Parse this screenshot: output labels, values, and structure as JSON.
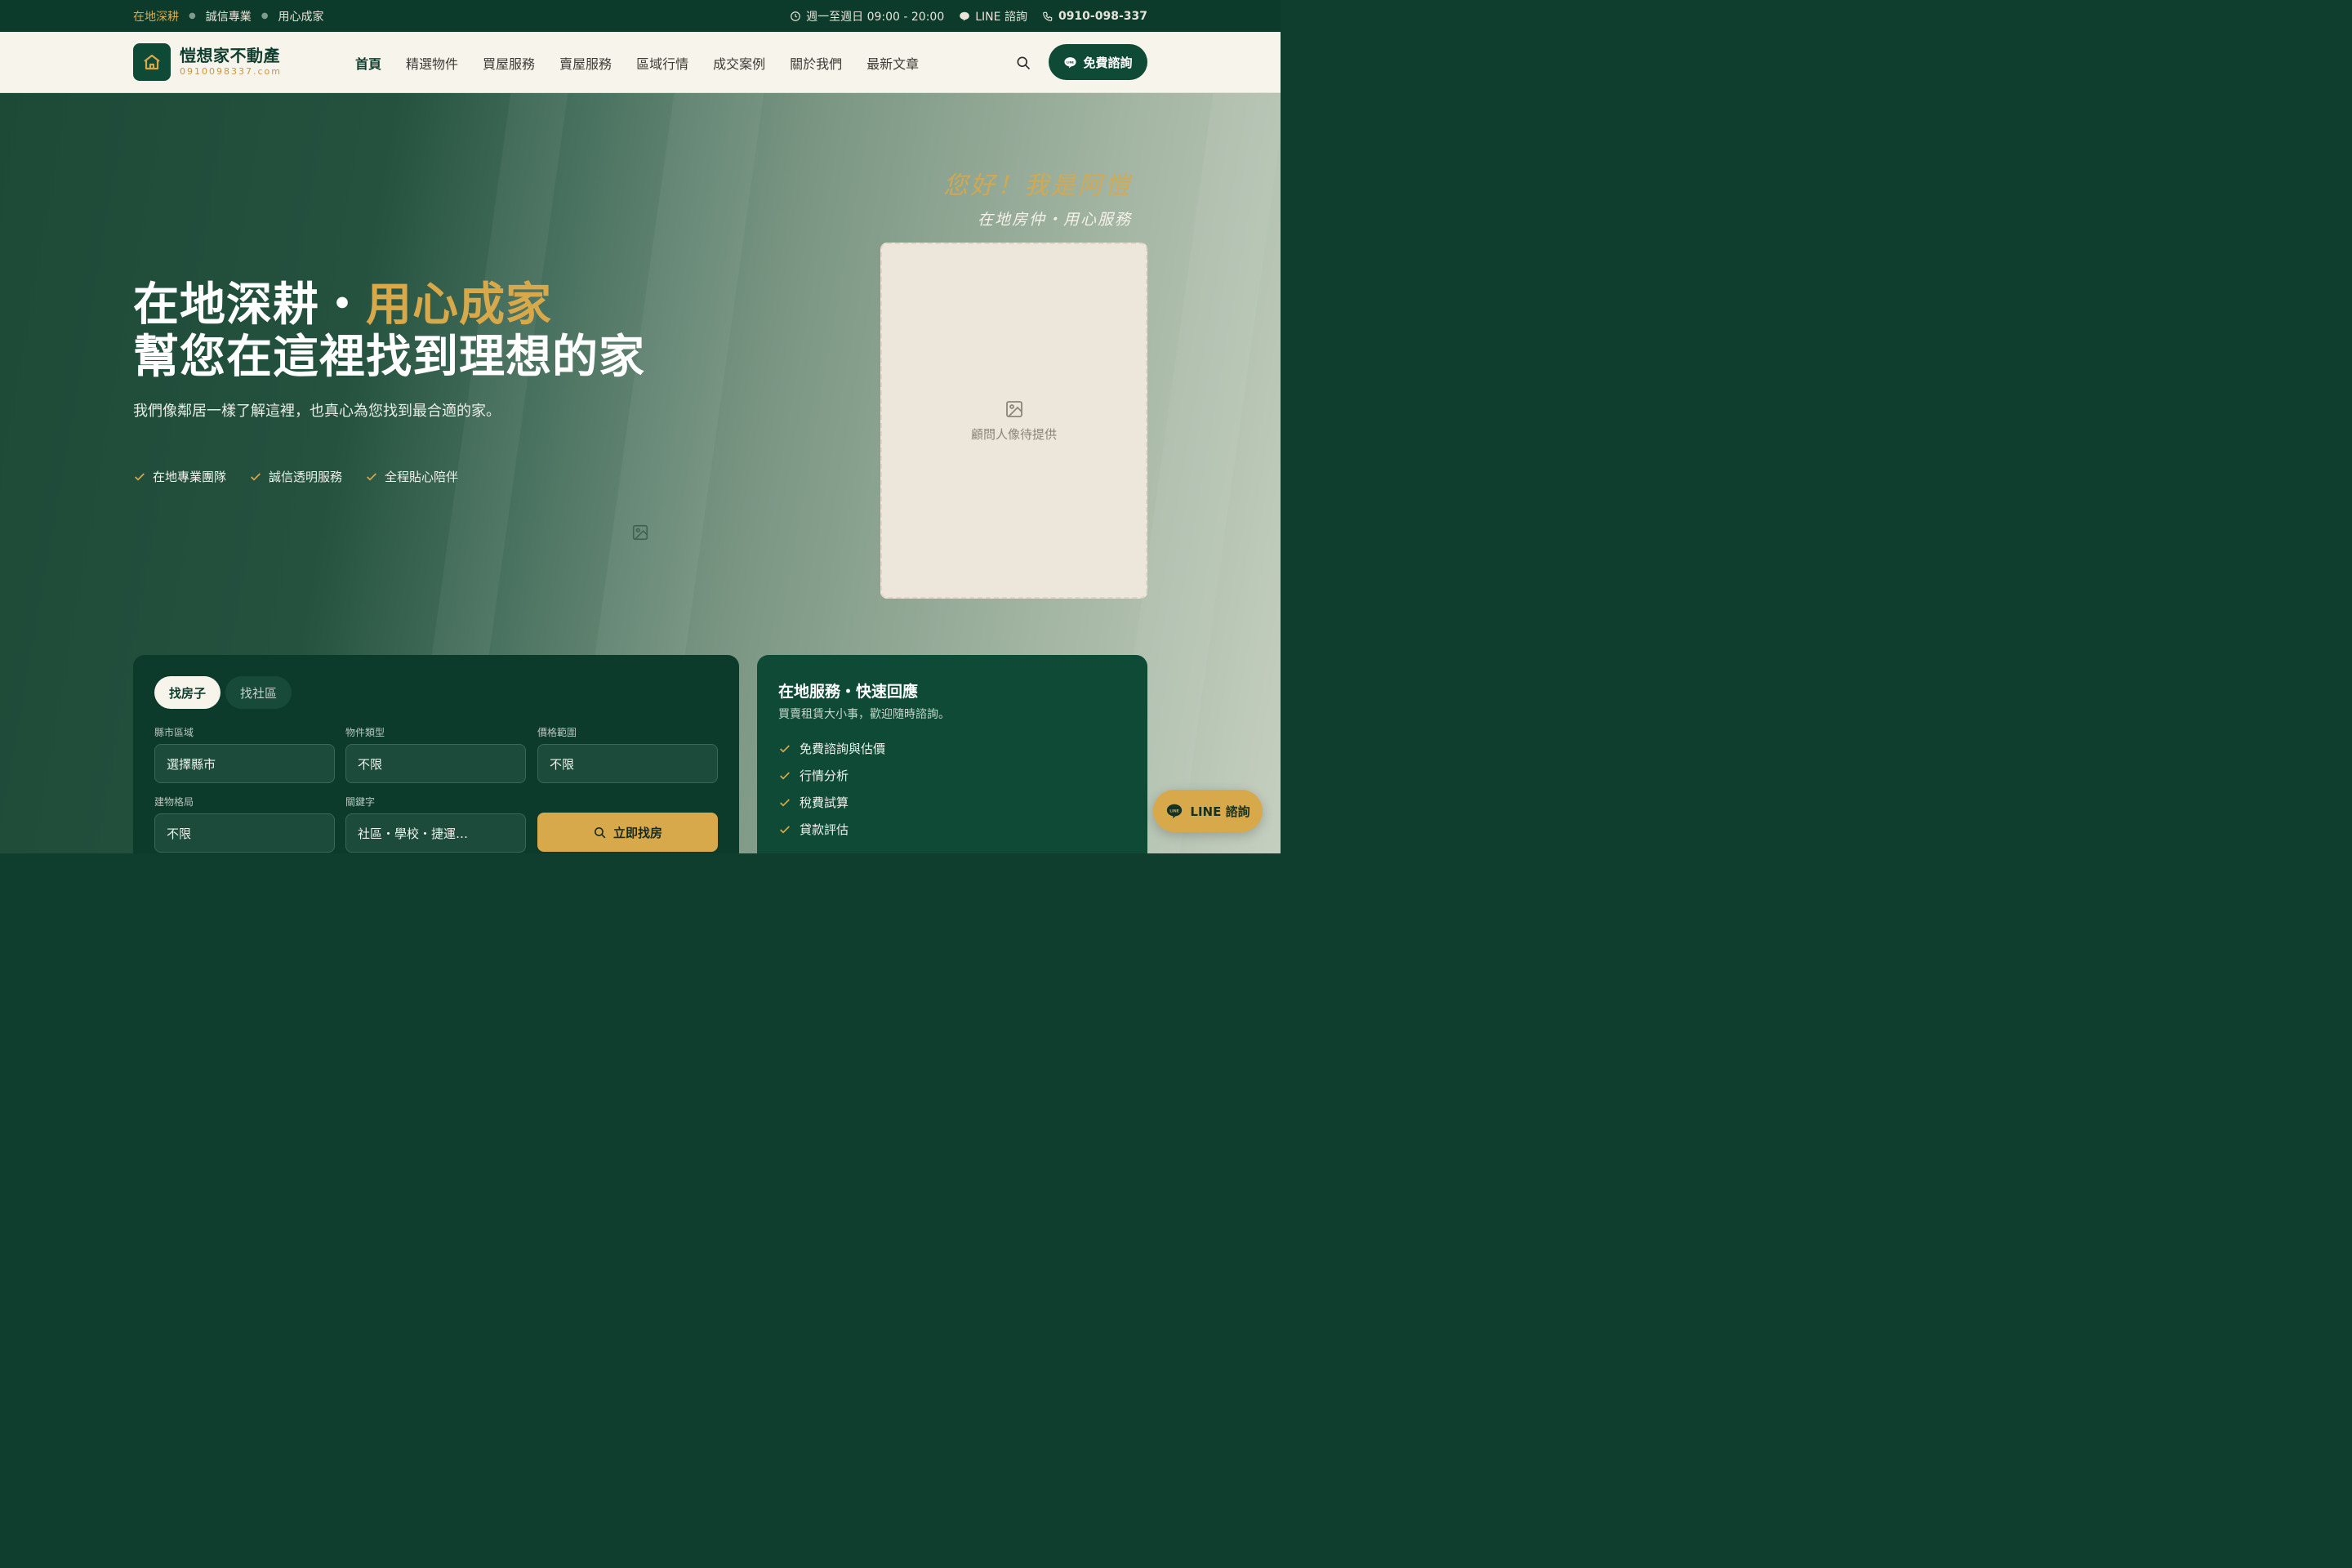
{
  "topbar": {
    "slogans": [
      "在地深耕",
      "誠信專業",
      "用心成家"
    ],
    "hours": "週一至週日 09:00 - 20:00",
    "line": "LINE 諮詢",
    "phone": "0910-098-337"
  },
  "header": {
    "brand_name": "愷想家不動產",
    "brand_domain": "0910098337.com",
    "nav": [
      "首頁",
      "精選物件",
      "買屋服務",
      "賣屋服務",
      "區域行情",
      "成交案例",
      "關於我們",
      "最新文章"
    ],
    "cta": "免費諮詢"
  },
  "hero": {
    "title_line1_white": "在地深耕・",
    "title_line1_gold": "用心成家",
    "title_line2": "幫您在這裡找到理想的家",
    "subtitle": "我們像鄰居一樣了解這裡，也真心為您找到最合適的家。",
    "features": [
      "在地專業團隊",
      "誠信透明服務",
      "全程貼心陪伴"
    ],
    "greeting": "您好！我是阿愷",
    "greeting_sub": "在地房仲・用心服務",
    "portrait_placeholder": "顧問人像待提供"
  },
  "search": {
    "tabs": [
      "找房子",
      "找社區"
    ],
    "fields": {
      "county": {
        "label": "縣市區域",
        "value": "選擇縣市"
      },
      "type": {
        "label": "物件類型",
        "value": "不限"
      },
      "price": {
        "label": "價格範圍",
        "value": "不限"
      },
      "layout": {
        "label": "建物格局",
        "value": "不限"
      },
      "keyword": {
        "label": "關鍵字",
        "value": "社區・學校・捷運…"
      }
    },
    "button": "立即找房"
  },
  "service": {
    "title": "在地服務・快速回應",
    "desc": "買賣租賃大小事，歡迎隨時諮詢。",
    "items": [
      "免費諮詢與估價",
      "行情分析",
      "稅費試算",
      "貸款評估"
    ]
  },
  "float": {
    "line": "LINE 諮詢"
  },
  "colors": {
    "primary": "#0f4a36",
    "dark": "#0c3a2b",
    "gold": "#d8a94a",
    "cream": "#f7f4ec"
  }
}
